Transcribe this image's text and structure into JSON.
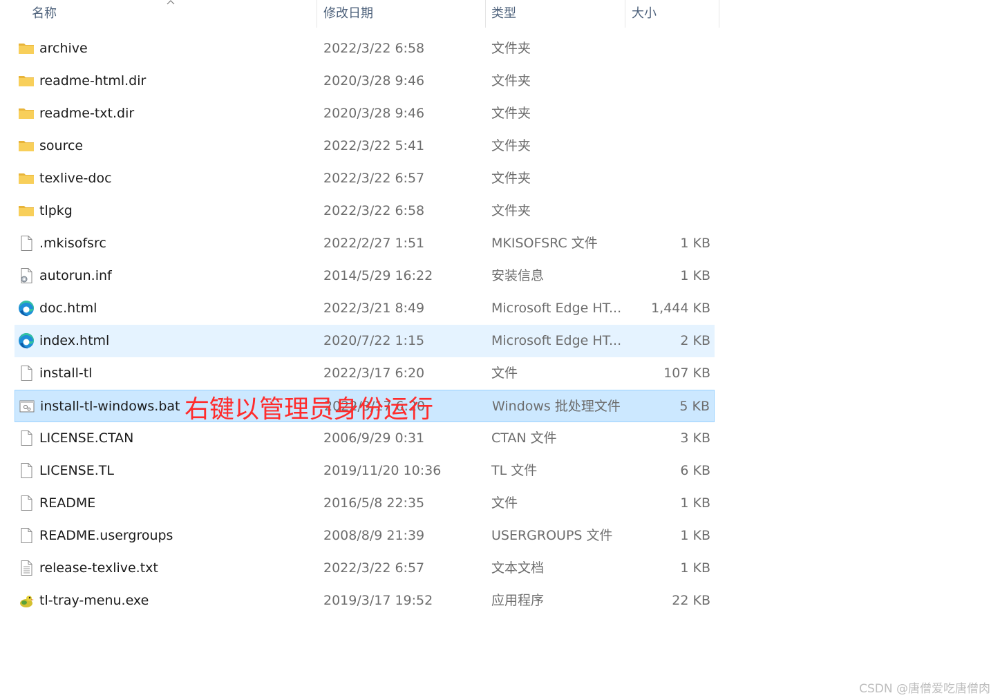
{
  "header": {
    "name": "名称",
    "date": "修改日期",
    "type": "类型",
    "size": "大小",
    "sort_icon": "sort-ascending-icon"
  },
  "files": [
    {
      "name": "archive",
      "date": "2022/3/22 6:58",
      "type": "文件夹",
      "size": "",
      "icon": "folder-icon"
    },
    {
      "name": "readme-html.dir",
      "date": "2020/3/28 9:46",
      "type": "文件夹",
      "size": "",
      "icon": "folder-icon"
    },
    {
      "name": "readme-txt.dir",
      "date": "2020/3/28 9:46",
      "type": "文件夹",
      "size": "",
      "icon": "folder-icon"
    },
    {
      "name": "source",
      "date": "2022/3/22 5:41",
      "type": "文件夹",
      "size": "",
      "icon": "folder-icon"
    },
    {
      "name": "texlive-doc",
      "date": "2022/3/22 6:57",
      "type": "文件夹",
      "size": "",
      "icon": "folder-icon"
    },
    {
      "name": "tlpkg",
      "date": "2022/3/22 6:58",
      "type": "文件夹",
      "size": "",
      "icon": "folder-icon"
    },
    {
      "name": ".mkisofsrc",
      "date": "2022/2/27 1:51",
      "type": "MKISOFSRC 文件",
      "size": "1 KB",
      "icon": "file-icon"
    },
    {
      "name": "autorun.inf",
      "date": "2014/5/29 16:22",
      "type": "安装信息",
      "size": "1 KB",
      "icon": "settings-file-icon"
    },
    {
      "name": "doc.html",
      "date": "2022/3/21 8:49",
      "type": "Microsoft Edge HT...",
      "size": "1,444 KB",
      "icon": "edge-icon"
    },
    {
      "name": "index.html",
      "date": "2020/7/22 1:15",
      "type": "Microsoft Edge HT...",
      "size": "2 KB",
      "icon": "edge-icon"
    },
    {
      "name": "install-tl",
      "date": "2022/3/17 6:20",
      "type": "文件",
      "size": "107 KB",
      "icon": "file-icon"
    },
    {
      "name": "install-tl-windows.bat",
      "date": "2022/3/17 6:20",
      "type": "Windows 批处理文件",
      "size": "5 KB",
      "icon": "batch-file-icon"
    },
    {
      "name": "LICENSE.CTAN",
      "date": "2006/9/29 0:31",
      "type": "CTAN 文件",
      "size": "3 KB",
      "icon": "file-icon"
    },
    {
      "name": "LICENSE.TL",
      "date": "2019/11/20 10:36",
      "type": "TL 文件",
      "size": "6 KB",
      "icon": "file-icon"
    },
    {
      "name": "README",
      "date": "2016/5/8 22:35",
      "type": "文件",
      "size": "1 KB",
      "icon": "file-icon"
    },
    {
      "name": "README.usergroups",
      "date": "2008/8/9 21:39",
      "type": "USERGROUPS 文件",
      "size": "1 KB",
      "icon": "file-icon"
    },
    {
      "name": "release-texlive.txt",
      "date": "2022/3/22 6:57",
      "type": "文本文档",
      "size": "1 KB",
      "icon": "text-file-icon"
    },
    {
      "name": "tl-tray-menu.exe",
      "date": "2019/3/17 19:52",
      "type": "应用程序",
      "size": "22 KB",
      "icon": "exe-icon"
    }
  ],
  "hover_row": "index.html",
  "selected_row": "install-tl-windows.bat",
  "annotation": "右键以管理员身份运行",
  "watermark": "CSDN @唐僧爱吃唐僧肉",
  "colors": {
    "selected_bg": "#cce8ff",
    "selected_border": "#99d1ff",
    "hover_bg": "#e5f3ff",
    "annotation": "#ff2b2b",
    "folder": "#f8c94a"
  }
}
